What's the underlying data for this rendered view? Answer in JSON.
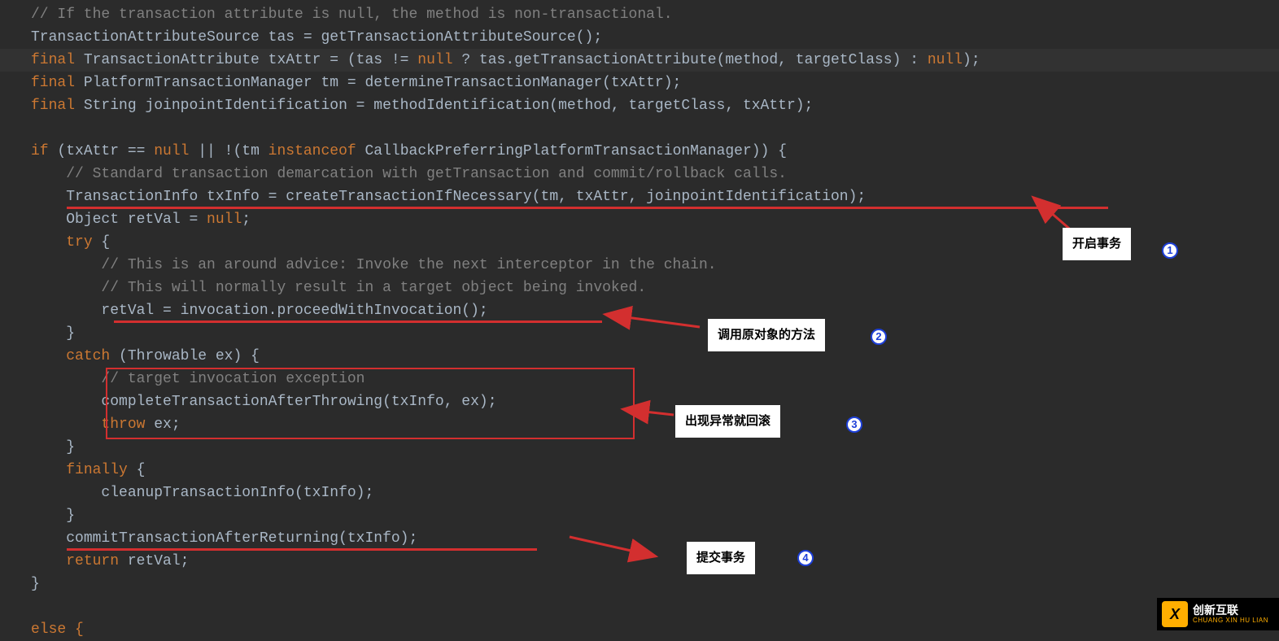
{
  "code": {
    "l1": "// If the transaction attribute is null, the method is non-transactional.",
    "l2a": "TransactionAttributeSource tas = getTransactionAttributeSource();",
    "l3_kw1": "final",
    "l3_a": " TransactionAttribute txAttr = (tas != ",
    "l3_kw2": "null",
    "l3_b": " ? tas.getTransactionAttribute(method, targetClass) : ",
    "l3_kw3": "null",
    "l3_c": ");",
    "l4_kw": "final",
    "l4_a": " PlatformTransactionManager tm = determineTransactionManager(txAttr);",
    "l5_kw": "final",
    "l5_a": " String joinpointIdentification = methodIdentification(method, targetClass, txAttr);",
    "l7_kw1": "if",
    "l7_a": " (txAttr == ",
    "l7_kw2": "null",
    "l7_b": " || !(tm ",
    "l7_kw3": "instanceof",
    "l7_c": " CallbackPreferringPlatformTransactionManager)) {",
    "l8": "// Standard transaction demarcation with getTransaction and commit/rollback calls.",
    "l9": "TransactionInfo txInfo = createTransactionIfNecessary(tm, txAttr, joinpointIdentification);",
    "l10_a": "Object retVal = ",
    "l10_kw": "null",
    "l10_b": ";",
    "l11_kw": "try",
    "l11_a": " {",
    "l12": "// This is an around advice: Invoke the next interceptor in the chain.",
    "l13": "// This will normally result in a target object being invoked.",
    "l14": "retVal = invocation.proceedWithInvocation();",
    "l15": "}",
    "l16_kw": "catch",
    "l16_a": " (Throwable ex) {",
    "l17": "// target invocation exception",
    "l18": "completeTransactionAfterThrowing(txInfo, ex);",
    "l19_kw": "throw",
    "l19_a": " ex;",
    "l20": "}",
    "l21_kw": "finally",
    "l21_a": " {",
    "l22": "cleanupTransactionInfo(txInfo);",
    "l23": "}",
    "l24": "commitTransactionAfterReturning(txInfo);",
    "l25_kw": "return",
    "l25_a": " retVal;",
    "l26": "}",
    "l28": "else {"
  },
  "labels": {
    "l1": "开启事务",
    "l2": "调用原对象的方法",
    "l3": "出现异常就回滚",
    "l4": "提交事务"
  },
  "numbers": {
    "n1": "1",
    "n2": "2",
    "n3": "3",
    "n4": "4"
  },
  "watermark": {
    "title": "创新互联",
    "sub": "CHUANG XIN HU LIAN",
    "logo": "X"
  }
}
